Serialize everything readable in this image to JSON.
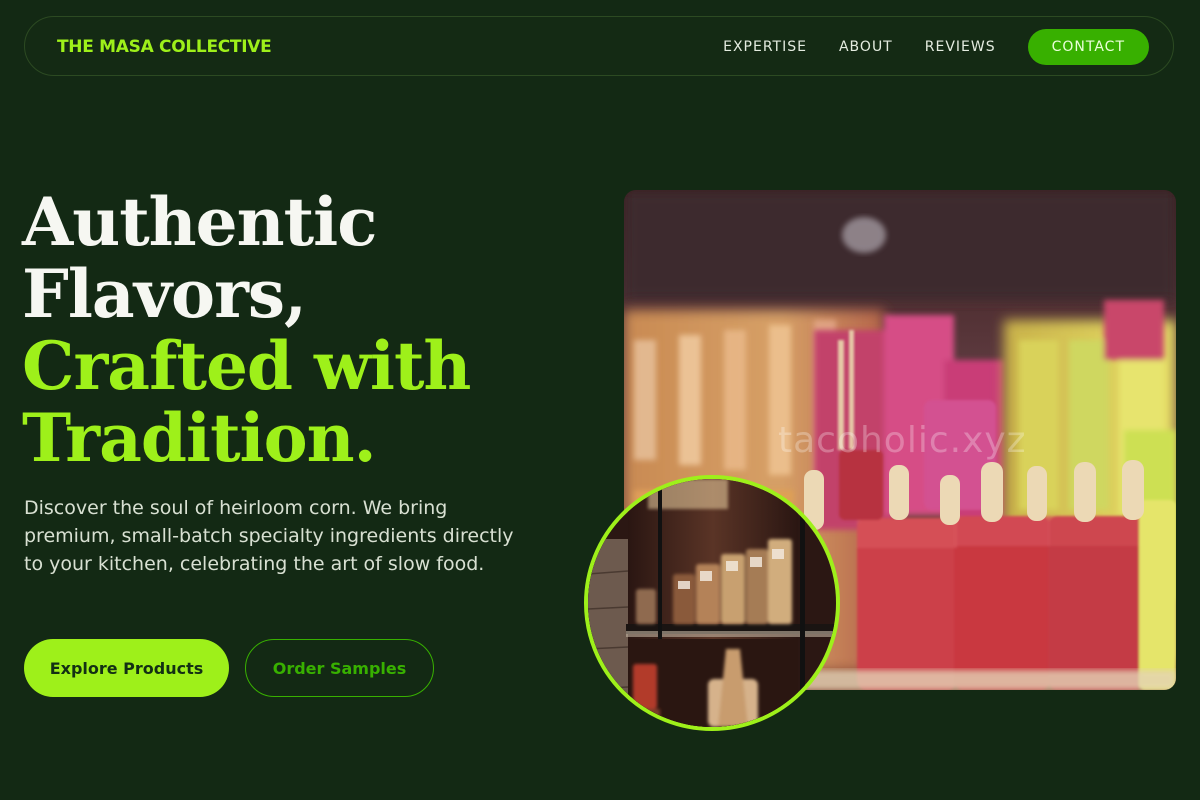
{
  "nav": {
    "brand": "THE MASA COLLECTIVE",
    "links": [
      "EXPERTISE",
      "ABOUT",
      "REVIEWS"
    ],
    "cta": "CONTACT"
  },
  "hero": {
    "headline_line1": "Authentic",
    "headline_line2": "Flavors,",
    "headline_line3": "Crafted with",
    "headline_line4": "Tradition.",
    "description": "Discover the soul of heirloom corn. We bring premium, small-batch specialty ingredients directly to your kitchen, celebrating the art of slow food.",
    "primary_button": "Explore Products",
    "secondary_button": "Order Samples"
  },
  "images": {
    "main_watermark": "tacoholic.xyz"
  },
  "colors": {
    "background": "#132914",
    "accent_lime": "#9ef01a",
    "accent_green": "#38b000",
    "text_light": "#f6f7f2"
  }
}
